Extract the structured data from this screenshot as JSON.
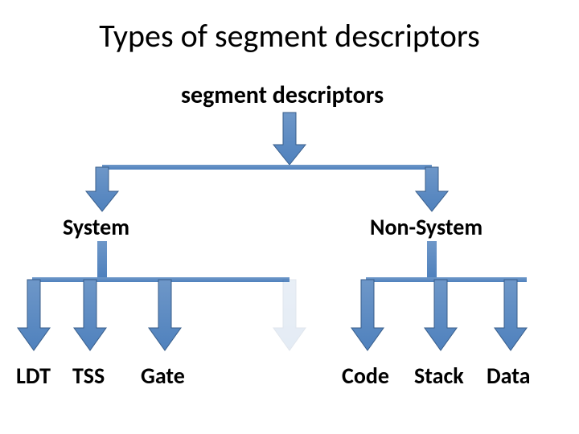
{
  "title": "Types of segment descriptors",
  "root": "segment descriptors",
  "level1": {
    "system": "System",
    "nonsystem": "Non-System"
  },
  "level2": {
    "system": {
      "ldt": "LDT",
      "tss": "TSS",
      "gate": "Gate"
    },
    "nonsystem": {
      "code": "Code",
      "stack": "Stack",
      "data": "Data"
    }
  },
  "arrow_color": "#4F81BD",
  "arrow_stroke": "#385D8A"
}
